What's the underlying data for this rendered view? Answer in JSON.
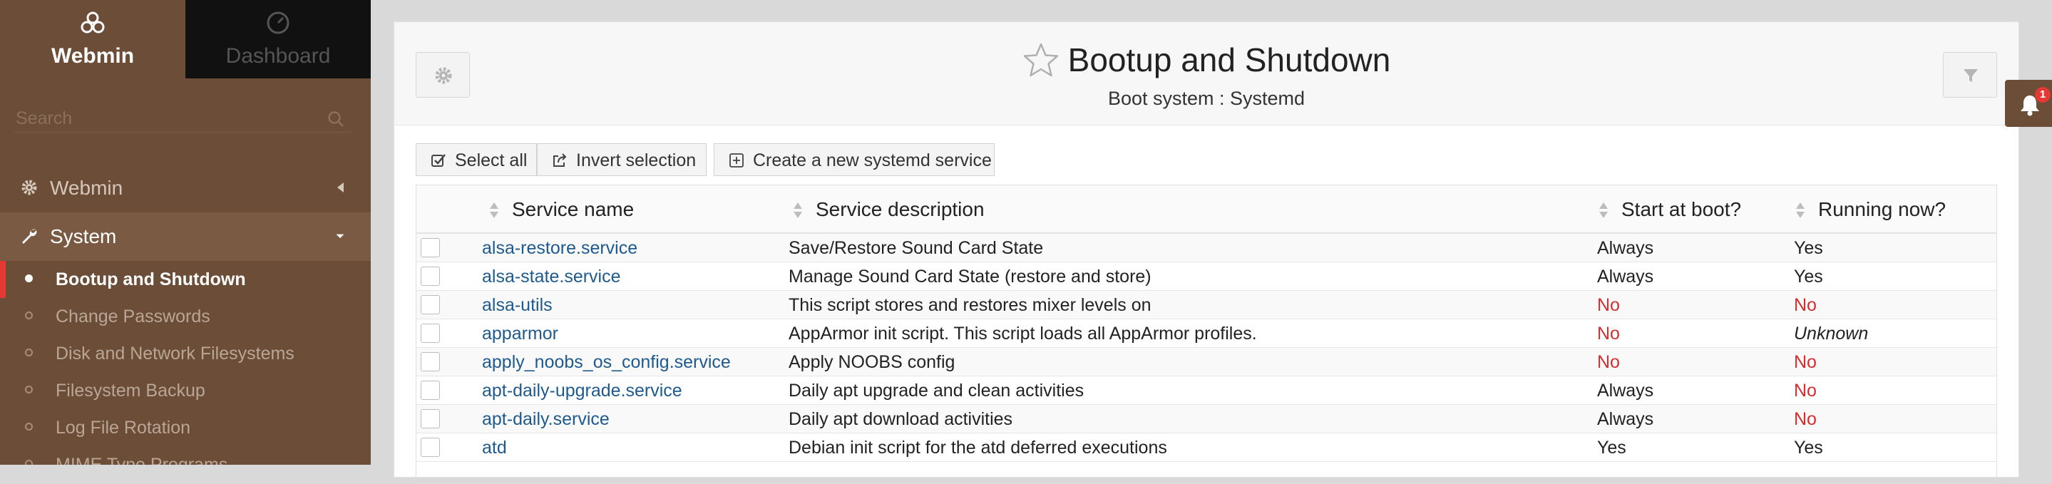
{
  "sidebar": {
    "tabs": [
      {
        "label": "Webmin",
        "icon": "webmin-logo-icon"
      },
      {
        "label": "Dashboard",
        "icon": "dashboard-gauge-icon"
      }
    ],
    "search": {
      "placeholder": "Search"
    },
    "categories": [
      {
        "label": "Webmin",
        "icon": "gear-icon",
        "expanded": false
      },
      {
        "label": "System",
        "icon": "wrench-icon",
        "expanded": true
      }
    ],
    "items": [
      {
        "label": "Bootup and Shutdown",
        "active": true
      },
      {
        "label": "Change Passwords",
        "active": false
      },
      {
        "label": "Disk and Network Filesystems",
        "active": false
      },
      {
        "label": "Filesystem Backup",
        "active": false
      },
      {
        "label": "Log File Rotation",
        "active": false
      },
      {
        "label": "MIME Type Programs",
        "active": false
      }
    ]
  },
  "header": {
    "title": "Bootup and Shutdown",
    "subtitle": "Boot system : Systemd"
  },
  "toolbar": {
    "select_all": "Select all",
    "invert": "Invert selection",
    "create": "Create a new systemd service"
  },
  "table": {
    "columns": [
      "Service name",
      "Service description",
      "Start at boot?",
      "Running now?"
    ],
    "rows": [
      {
        "name": "alsa-restore.service",
        "desc": "Save/Restore Sound Card State",
        "boot": "Always",
        "running": "Yes"
      },
      {
        "name": "alsa-state.service",
        "desc": "Manage Sound Card State (restore and store)",
        "boot": "Always",
        "running": "Yes"
      },
      {
        "name": "alsa-utils",
        "desc": "This script stores and restores mixer levels on",
        "boot": "No",
        "running": "No"
      },
      {
        "name": "apparmor",
        "desc": "AppArmor init script. This script loads all AppArmor profiles.",
        "boot": "No",
        "running": "Unknown"
      },
      {
        "name": "apply_noobs_os_config.service",
        "desc": "Apply NOOBS config",
        "boot": "No",
        "running": "No"
      },
      {
        "name": "apt-daily-upgrade.service",
        "desc": "Daily apt upgrade and clean activities",
        "boot": "Always",
        "running": "No"
      },
      {
        "name": "apt-daily.service",
        "desc": "Daily apt download activities",
        "boot": "Always",
        "running": "No"
      },
      {
        "name": "atd",
        "desc": "Debian init script for the atd deferred executions",
        "boot": "Yes",
        "running": "Yes"
      }
    ]
  },
  "notifications": {
    "count": "1",
    "icon": "bell-icon"
  },
  "colors": {
    "sidebar": "#6b4d38",
    "active_marker": "#e53935",
    "link": "#1f5a8f",
    "negative": "#d32f2f"
  }
}
